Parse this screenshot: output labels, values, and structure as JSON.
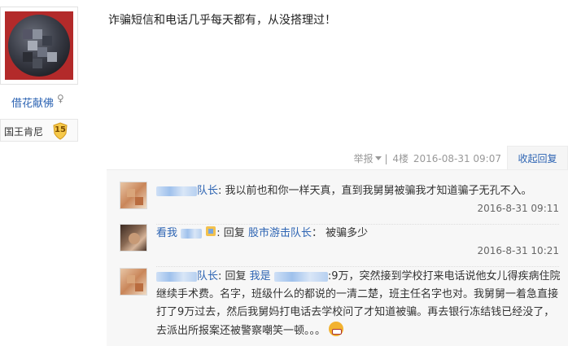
{
  "user": {
    "username": "借花献佛",
    "gender_icon": "♀",
    "rank_name": "国王肯尼",
    "level": "15"
  },
  "post": {
    "body": "诈骗短信和电话几乎每天都有，从没搭理过！",
    "report_label": "举报",
    "floor": "4楼",
    "time": "2016-08-31 09:07",
    "collapse_label": "收起回复"
  },
  "replies": [
    {
      "name_suffix": "队长",
      "text": ": 我以前也和你一样天真，直到我舅舅被骗我才知道骗子无孔不入。",
      "time": "2016-8-31 09:11"
    },
    {
      "name_prefix": "看我",
      "reply_label": ": 回复",
      "reply_to": "股市游击队长",
      "text": "：  被骗多少",
      "time": "2016-8-31 10:21"
    },
    {
      "name_suffix": "队长",
      "reply_label": ": 回复",
      "reply_to_prefix": "我是",
      "text": ":9万，突然接到学校打来电话说他女儿得疾病住院继续手术费。名字，班级什么的都说的一清二楚，班主任名字也对。我舅舅一着急直接打了9万过去，然后我舅妈打电话去学校问了才知道被骗。再去银行冻结钱已经没了，去派出所报案还被警察嘲笑一顿。。。"
    }
  ],
  "colors": {
    "link": "#2d64b3",
    "username": "#e0772b",
    "reply_bg": "#f7f7f7"
  }
}
